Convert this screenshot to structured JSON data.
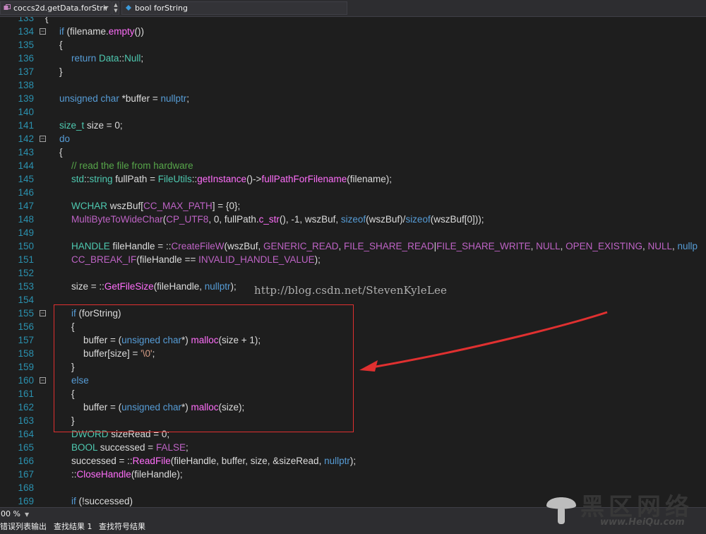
{
  "toolbar": {
    "scope_dropdown": "coccs2d.getData.forStrir",
    "member_dropdown": "bool forString"
  },
  "code": {
    "lines": [
      {
        "n": "133",
        "indent": 0,
        "fold": "",
        "tokens": [
          {
            "c": "tx",
            "t": "{"
          }
        ]
      },
      {
        "n": "134",
        "indent": 1,
        "fold": "minus",
        "tokens": [
          {
            "c": "kw",
            "t": "if"
          },
          {
            "c": "tx",
            "t": " (filename."
          },
          {
            "c": "fn",
            "t": "empty"
          },
          {
            "c": "tx",
            "t": "())"
          }
        ]
      },
      {
        "n": "135",
        "indent": 1,
        "fold": "",
        "tokens": [
          {
            "c": "tx",
            "t": "{"
          }
        ]
      },
      {
        "n": "136",
        "indent": 2,
        "fold": "",
        "tokens": [
          {
            "c": "kw",
            "t": "return"
          },
          {
            "c": "tx",
            "t": " "
          },
          {
            "c": "ty",
            "t": "Data"
          },
          {
            "c": "tx",
            "t": "::"
          },
          {
            "c": "ty",
            "t": "Null"
          },
          {
            "c": "tx",
            "t": ";"
          }
        ]
      },
      {
        "n": "137",
        "indent": 1,
        "fold": "",
        "tokens": [
          {
            "c": "tx",
            "t": "}"
          }
        ]
      },
      {
        "n": "138",
        "indent": 0,
        "fold": "",
        "tokens": []
      },
      {
        "n": "139",
        "indent": 1,
        "fold": "",
        "tokens": [
          {
            "c": "kw",
            "t": "unsigned char"
          },
          {
            "c": "tx",
            "t": " *buffer = "
          },
          {
            "c": "kw",
            "t": "nullptr"
          },
          {
            "c": "tx",
            "t": ";"
          }
        ]
      },
      {
        "n": "140",
        "indent": 0,
        "fold": "",
        "tokens": []
      },
      {
        "n": "141",
        "indent": 1,
        "fold": "",
        "tokens": [
          {
            "c": "ty",
            "t": "size_t"
          },
          {
            "c": "tx",
            "t": " size = 0;"
          }
        ]
      },
      {
        "n": "142",
        "indent": 1,
        "fold": "minus",
        "tokens": [
          {
            "c": "kw",
            "t": "do"
          }
        ]
      },
      {
        "n": "143",
        "indent": 1,
        "fold": "",
        "tokens": [
          {
            "c": "tx",
            "t": "{"
          }
        ]
      },
      {
        "n": "144",
        "indent": 2,
        "fold": "",
        "tokens": [
          {
            "c": "cm",
            "t": "// read the file from hardware"
          }
        ]
      },
      {
        "n": "145",
        "indent": 2,
        "fold": "",
        "tokens": [
          {
            "c": "ty",
            "t": "std"
          },
          {
            "c": "tx",
            "t": "::"
          },
          {
            "c": "ty",
            "t": "string"
          },
          {
            "c": "tx",
            "t": " fullPath = "
          },
          {
            "c": "ty",
            "t": "FileUtils"
          },
          {
            "c": "tx",
            "t": "::"
          },
          {
            "c": "fn",
            "t": "getInstance"
          },
          {
            "c": "tx",
            "t": "()->"
          },
          {
            "c": "fn",
            "t": "fullPathForFilename"
          },
          {
            "c": "tx",
            "t": "(filename);"
          }
        ]
      },
      {
        "n": "146",
        "indent": 0,
        "fold": "",
        "tokens": []
      },
      {
        "n": "147",
        "indent": 2,
        "fold": "",
        "tokens": [
          {
            "c": "ty",
            "t": "WCHAR"
          },
          {
            "c": "tx",
            "t": " wszBuf["
          },
          {
            "c": "mac",
            "t": "CC_MAX_PATH"
          },
          {
            "c": "tx",
            "t": "] = {0};"
          }
        ]
      },
      {
        "n": "148",
        "indent": 2,
        "fold": "",
        "tokens": [
          {
            "c": "mac",
            "t": "MultiByteToWideChar"
          },
          {
            "c": "tx",
            "t": "("
          },
          {
            "c": "mac",
            "t": "CP_UTF8"
          },
          {
            "c": "tx",
            "t": ", 0, fullPath."
          },
          {
            "c": "fn",
            "t": "c_str"
          },
          {
            "c": "tx",
            "t": "(), -1, wszBuf, "
          },
          {
            "c": "kw",
            "t": "sizeof"
          },
          {
            "c": "tx",
            "t": "(wszBuf)/"
          },
          {
            "c": "kw",
            "t": "sizeof"
          },
          {
            "c": "tx",
            "t": "(wszBuf[0]));"
          }
        ]
      },
      {
        "n": "149",
        "indent": 0,
        "fold": "",
        "tokens": []
      },
      {
        "n": "150",
        "indent": 2,
        "fold": "",
        "tokens": [
          {
            "c": "ty",
            "t": "HANDLE"
          },
          {
            "c": "tx",
            "t": " fileHandle = ::"
          },
          {
            "c": "mac",
            "t": "CreateFileW"
          },
          {
            "c": "tx",
            "t": "(wszBuf, "
          },
          {
            "c": "mac",
            "t": "GENERIC_READ"
          },
          {
            "c": "tx",
            "t": ", "
          },
          {
            "c": "mac",
            "t": "FILE_SHARE_READ"
          },
          {
            "c": "tx",
            "t": "|"
          },
          {
            "c": "mac",
            "t": "FILE_SHARE_WRITE"
          },
          {
            "c": "tx",
            "t": ", "
          },
          {
            "c": "mac",
            "t": "NULL"
          },
          {
            "c": "tx",
            "t": ", "
          },
          {
            "c": "mac",
            "t": "OPEN_EXISTING"
          },
          {
            "c": "tx",
            "t": ", "
          },
          {
            "c": "mac",
            "t": "NULL"
          },
          {
            "c": "tx",
            "t": ", "
          },
          {
            "c": "kw",
            "t": "nullp"
          }
        ]
      },
      {
        "n": "151",
        "indent": 2,
        "fold": "",
        "tokens": [
          {
            "c": "mac",
            "t": "CC_BREAK_IF"
          },
          {
            "c": "tx",
            "t": "(fileHandle == "
          },
          {
            "c": "mac",
            "t": "INVALID_HANDLE_VALUE"
          },
          {
            "c": "tx",
            "t": ");"
          }
        ]
      },
      {
        "n": "152",
        "indent": 0,
        "fold": "",
        "tokens": []
      },
      {
        "n": "153",
        "indent": 2,
        "fold": "",
        "tokens": [
          {
            "c": "tx",
            "t": "size = ::"
          },
          {
            "c": "fn",
            "t": "GetFileSize"
          },
          {
            "c": "tx",
            "t": "(fileHandle, "
          },
          {
            "c": "kw",
            "t": "nullptr"
          },
          {
            "c": "tx",
            "t": ");"
          }
        ]
      },
      {
        "n": "154",
        "indent": 0,
        "fold": "",
        "tokens": []
      },
      {
        "n": "155",
        "indent": 2,
        "fold": "minus",
        "tokens": [
          {
            "c": "kw",
            "t": "if"
          },
          {
            "c": "tx",
            "t": " (forString)"
          }
        ]
      },
      {
        "n": "156",
        "indent": 2,
        "fold": "",
        "tokens": [
          {
            "c": "tx",
            "t": "{"
          }
        ]
      },
      {
        "n": "157",
        "indent": 3,
        "fold": "",
        "tokens": [
          {
            "c": "tx",
            "t": "buffer = ("
          },
          {
            "c": "kw",
            "t": "unsigned char"
          },
          {
            "c": "tx",
            "t": "*) "
          },
          {
            "c": "fn",
            "t": "malloc"
          },
          {
            "c": "tx",
            "t": "(size + 1);"
          }
        ]
      },
      {
        "n": "158",
        "indent": 3,
        "fold": "",
        "tokens": [
          {
            "c": "tx",
            "t": "buffer[size] = "
          },
          {
            "c": "str",
            "t": "'\\0'"
          },
          {
            "c": "tx",
            "t": ";"
          }
        ]
      },
      {
        "n": "159",
        "indent": 2,
        "fold": "",
        "tokens": [
          {
            "c": "tx",
            "t": "}"
          }
        ]
      },
      {
        "n": "160",
        "indent": 2,
        "fold": "minus",
        "tokens": [
          {
            "c": "kw",
            "t": "else"
          }
        ]
      },
      {
        "n": "161",
        "indent": 2,
        "fold": "",
        "tokens": [
          {
            "c": "tx",
            "t": "{"
          }
        ]
      },
      {
        "n": "162",
        "indent": 3,
        "fold": "",
        "tokens": [
          {
            "c": "tx",
            "t": "buffer = ("
          },
          {
            "c": "kw",
            "t": "unsigned char"
          },
          {
            "c": "tx",
            "t": "*) "
          },
          {
            "c": "fn",
            "t": "malloc"
          },
          {
            "c": "tx",
            "t": "(size);"
          }
        ]
      },
      {
        "n": "163",
        "indent": 2,
        "fold": "",
        "tokens": [
          {
            "c": "tx",
            "t": "}"
          }
        ]
      },
      {
        "n": "164",
        "indent": 2,
        "fold": "",
        "tokens": [
          {
            "c": "ty",
            "t": "DWORD"
          },
          {
            "c": "tx",
            "t": " sizeRead = 0;"
          }
        ]
      },
      {
        "n": "165",
        "indent": 2,
        "fold": "",
        "tokens": [
          {
            "c": "ty",
            "t": "BOOL"
          },
          {
            "c": "tx",
            "t": " successed = "
          },
          {
            "c": "mac",
            "t": "FALSE"
          },
          {
            "c": "tx",
            "t": ";"
          }
        ]
      },
      {
        "n": "166",
        "indent": 2,
        "fold": "",
        "tokens": [
          {
            "c": "tx",
            "t": "successed = ::"
          },
          {
            "c": "fn",
            "t": "ReadFile"
          },
          {
            "c": "tx",
            "t": "(fileHandle, buffer, size, &sizeRead, "
          },
          {
            "c": "kw",
            "t": "nullptr"
          },
          {
            "c": "tx",
            "t": ");"
          }
        ]
      },
      {
        "n": "167",
        "indent": 2,
        "fold": "",
        "tokens": [
          {
            "c": "tx",
            "t": "::"
          },
          {
            "c": "fn",
            "t": "CloseHandle"
          },
          {
            "c": "tx",
            "t": "(fileHandle);"
          }
        ]
      },
      {
        "n": "168",
        "indent": 0,
        "fold": "",
        "tokens": []
      },
      {
        "n": "169",
        "indent": 2,
        "fold": "",
        "tokens": [
          {
            "c": "kw",
            "t": "if"
          },
          {
            "c": "tx",
            "t": " (!successed)"
          }
        ]
      }
    ]
  },
  "watermark": "http://blog.csdn.net/StevenKyleLee",
  "statusbar": {
    "zoom": "00 %"
  },
  "bottom_tabs": [
    "错误列表",
    "输出",
    "查找结果 1",
    "查找符号结果"
  ],
  "logo": {
    "name": "黑区网络",
    "url": "www.HeiQu.com"
  },
  "colors": {
    "background": "#1e1e1e",
    "line_number": "#2b91af",
    "keyword": "#569cd6",
    "function": "#ff6efa",
    "comment": "#57a64a",
    "annotation_red": "#e03030"
  }
}
